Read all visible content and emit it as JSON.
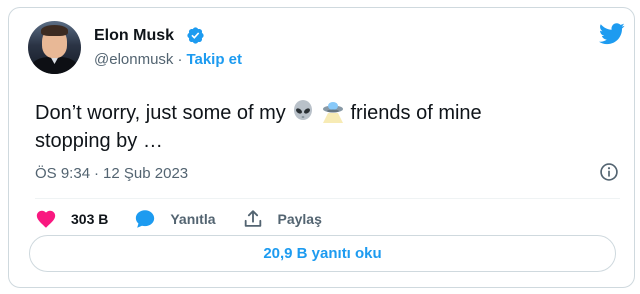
{
  "author": {
    "name": "Elon Musk",
    "handle": "@elonmusk",
    "separator": "·",
    "follow_label": "Takip et"
  },
  "tweet": {
    "text_part1": "Don’t worry, just some of my",
    "text_part2": "friends of mine",
    "text_part3": "stopping by …",
    "time": "ÖS 9:34",
    "meta_separator": "·",
    "date": "12 Şub 2023"
  },
  "actions": {
    "likes_count": "303 B",
    "reply_label": "Yanıtla",
    "share_label": "Paylaş"
  },
  "read_replies_label": "20,9 B yanıtı oku",
  "icons": {
    "verified": "verified-badge-icon",
    "brand": "twitter-bird-icon",
    "info": "info-icon",
    "like": "heart-icon",
    "reply": "speech-bubble-icon",
    "share": "share-icon",
    "emoji1": "alien-emoji",
    "emoji2": "ufo-emoji"
  },
  "colors": {
    "accent": "#1d9bf0",
    "like": "#f91880",
    "text": "#0f1419",
    "muted": "#536471",
    "border": "#cfd9de"
  }
}
